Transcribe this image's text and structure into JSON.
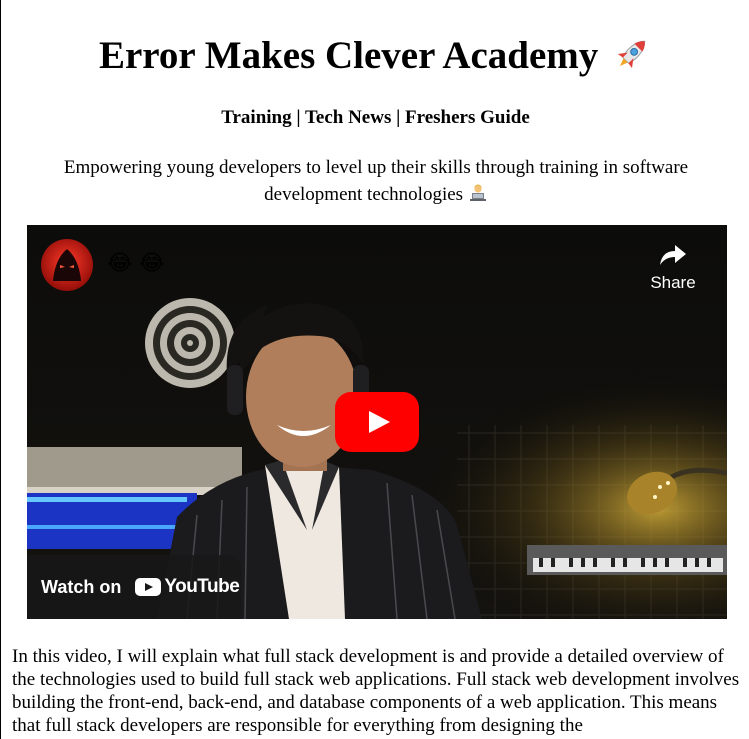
{
  "header": {
    "title": "Error Makes Clever Academy",
    "title_emoji": "rocket",
    "nav": "Training | Tech News | Freshers Guide",
    "tagline": "Empowering young developers to level up their skills through training in software development technologies",
    "tagline_emoji": "technologist-laptop"
  },
  "video": {
    "emojis": [
      "😂",
      "😂"
    ],
    "share_label": "Share",
    "watch_on_label": "Watch on",
    "youtube_label": "YouTube",
    "colors": {
      "youtube_red": "#ff0000",
      "overlay": "#171717"
    }
  },
  "description": {
    "text": "In this video, I will explain what full stack development is and provide a detailed overview of the technologies used to build full stack web applications. Full stack web development involves building the front-end, back-end, and database components of a web application. This means that full stack developers are responsible for everything from designing the"
  }
}
